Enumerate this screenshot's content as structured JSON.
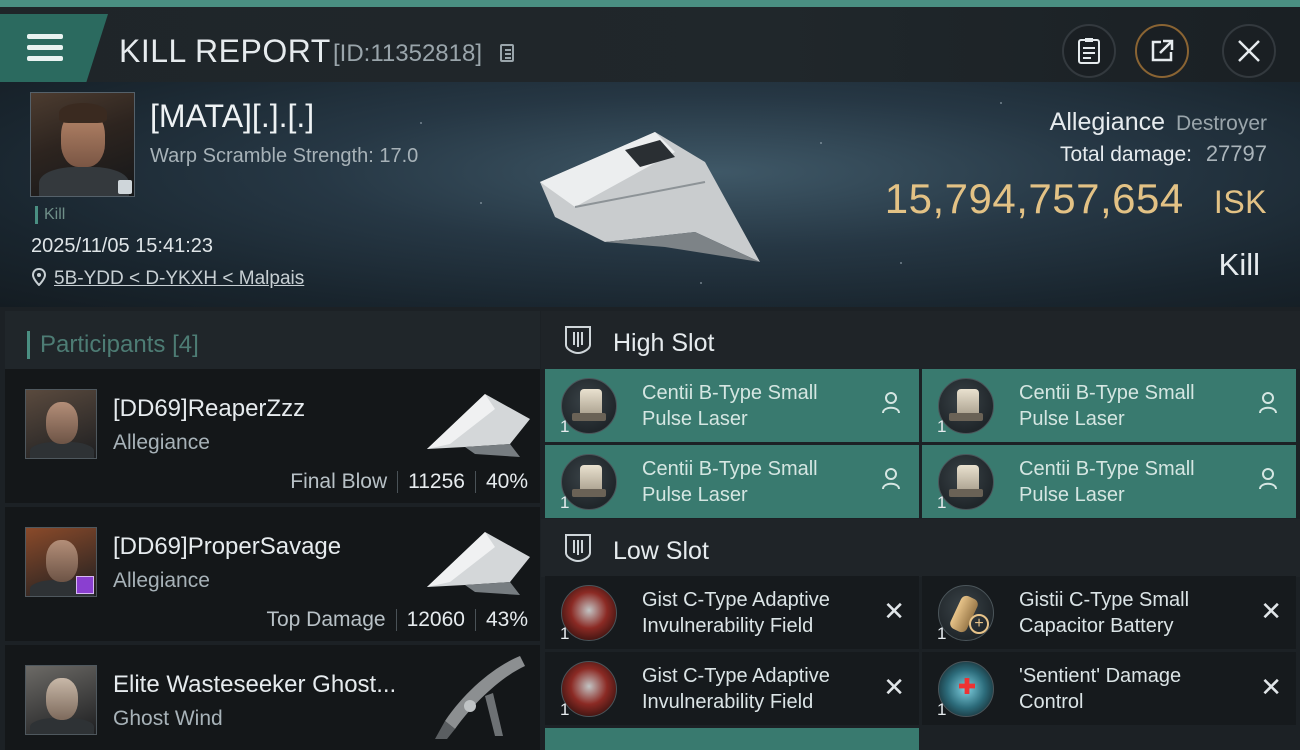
{
  "header": {
    "title": "KILL REPORT",
    "id_text": "[ID:11352818]"
  },
  "victim": {
    "name": "[MATA][.].[.]",
    "warp_scramble": "Warp Scramble Strength: 17.0",
    "kill_tag": "Kill",
    "datetime": "2025/11/05 15:41:23",
    "location": "5B-YDD < D-YKXH < Malpais",
    "ship_name": "Allegiance",
    "ship_class": "Destroyer",
    "total_damage_label": "Total damage:",
    "total_damage_value": "27797",
    "isk_value": "15,794,757,654",
    "isk_unit": "ISK",
    "result": "Kill"
  },
  "participants": {
    "title": "Participants",
    "count": "[4]",
    "rows": [
      {
        "name": "[DD69]ReaperZzz",
        "ship": "Allegiance",
        "role": "Final Blow",
        "damage": "11256",
        "percent": "40%"
      },
      {
        "name": "[DD69]ProperSavage",
        "ship": "Allegiance",
        "role": "Top Damage",
        "damage": "12060",
        "percent": "43%"
      },
      {
        "name": "Elite Wasteseeker Ghost...",
        "ship": "Ghost Wind",
        "role": "",
        "damage": "",
        "percent": ""
      }
    ]
  },
  "fittings": {
    "high_slot_label": "High Slot",
    "low_slot_label": "Low Slot",
    "high": [
      {
        "name": "Centii B-Type Small Pulse Laser",
        "qty": "1"
      },
      {
        "name": "Centii B-Type Small Pulse Laser",
        "qty": "1"
      },
      {
        "name": "Centii B-Type Small Pulse Laser",
        "qty": "1"
      },
      {
        "name": "Centii B-Type Small Pulse Laser",
        "qty": "1"
      }
    ],
    "low": [
      {
        "name": "Gist C-Type Adaptive Invulnerability Field",
        "qty": "1"
      },
      {
        "name": "Gistii C-Type Small Capacitor Battery",
        "qty": "1"
      },
      {
        "name": "Gist C-Type Adaptive Invulnerability Field",
        "qty": "1"
      },
      {
        "name": "'Sentient' Damage Control",
        "qty": "1"
      }
    ]
  },
  "colors": {
    "accent": "#4a8f82",
    "high_slot_bg": "#397a6f",
    "isk": "#e3c285"
  },
  "icons": [
    "menu-icon",
    "copy-icon",
    "clipboard-icon",
    "share-icon",
    "close-icon",
    "location-pin-icon",
    "high-slot-icon",
    "low-slot-icon",
    "pilot-icon",
    "remove-icon"
  ]
}
